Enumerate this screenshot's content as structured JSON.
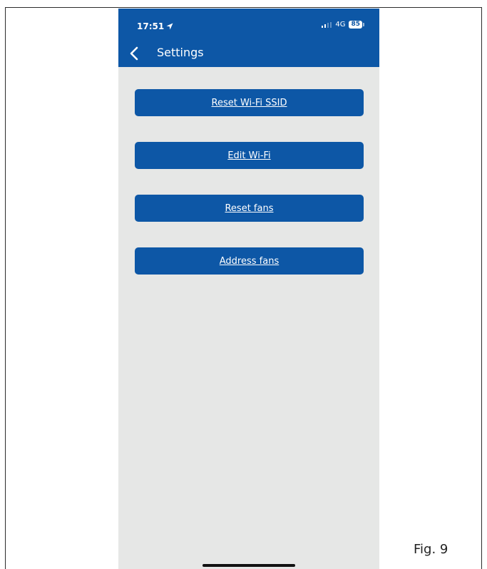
{
  "status_bar": {
    "time": "17:51",
    "network": "4G",
    "battery": "85"
  },
  "nav": {
    "title": "Settings"
  },
  "buttons": [
    {
      "label": "Reset Wi-Fi SSID"
    },
    {
      "label": "Edit Wi-Fi"
    },
    {
      "label": "Reset fans"
    },
    {
      "label": "Address fans"
    }
  ],
  "figure": {
    "caption": "Fig. 9"
  },
  "colors": {
    "header": "#0d57a6",
    "background": "#e6e7e6",
    "button": "#0d57a6"
  },
  "icons": {
    "back": "chevron-left-icon",
    "location": "location-arrow-icon"
  }
}
